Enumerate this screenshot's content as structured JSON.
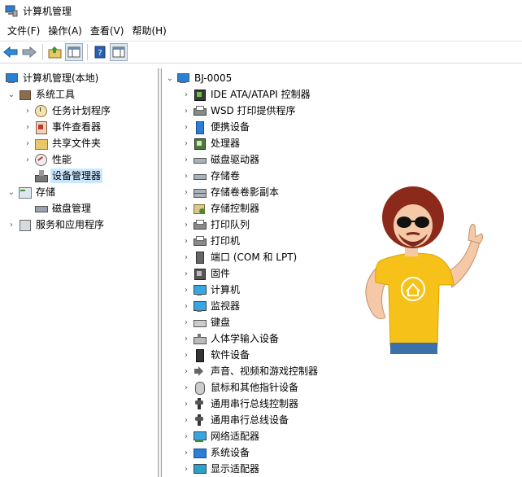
{
  "window": {
    "title": "计算机管理"
  },
  "menu": [
    "文件(F)",
    "操作(A)",
    "查看(V)",
    "帮助(H)"
  ],
  "toolbar": [
    "back-icon",
    "forward-icon",
    "up-folder-icon",
    "show-hide-tree-icon",
    "help-icon",
    "properties-icon"
  ],
  "left_tree": [
    {
      "label": "计算机管理(本地)",
      "icon": "computer-manage-icon",
      "level": 0,
      "arrow": ""
    },
    {
      "label": "系统工具",
      "icon": "tools-icon",
      "level": 1,
      "arrow": "expanded"
    },
    {
      "label": "任务计划程序",
      "icon": "clock-icon",
      "level": 2,
      "arrow": "collapsed"
    },
    {
      "label": "事件查看器",
      "icon": "event-viewer-icon",
      "level": 2,
      "arrow": "collapsed"
    },
    {
      "label": "共享文件夹",
      "icon": "shared-folder-icon",
      "level": 2,
      "arrow": "collapsed"
    },
    {
      "label": "性能",
      "icon": "performance-icon",
      "level": 2,
      "arrow": "collapsed"
    },
    {
      "label": "设备管理器",
      "icon": "device-manager-icon",
      "level": 2,
      "arrow": "",
      "selected": true
    },
    {
      "label": "存储",
      "icon": "storage-icon",
      "level": 1,
      "arrow": "expanded"
    },
    {
      "label": "磁盘管理",
      "icon": "disk-icon",
      "level": 2,
      "arrow": ""
    },
    {
      "label": "服务和应用程序",
      "icon": "services-icon",
      "level": 1,
      "arrow": "collapsed"
    }
  ],
  "device_tree": {
    "root": "BJ-0005",
    "items": [
      {
        "label": "IDE ATA/ATAPI 控制器",
        "icon": "ide-controller-icon"
      },
      {
        "label": "WSD 打印提供程序",
        "icon": "printer-icon"
      },
      {
        "label": "便携设备",
        "icon": "portable-device-icon"
      },
      {
        "label": "处理器",
        "icon": "processor-icon"
      },
      {
        "label": "磁盘驱动器",
        "icon": "disk-drive-icon"
      },
      {
        "label": "存储卷",
        "icon": "storage-volume-icon"
      },
      {
        "label": "存储卷卷影副本",
        "icon": "shadow-copy-icon"
      },
      {
        "label": "存储控制器",
        "icon": "storage-controller-icon"
      },
      {
        "label": "打印队列",
        "icon": "print-queue-icon"
      },
      {
        "label": "打印机",
        "icon": "printer-icon"
      },
      {
        "label": "端口 (COM 和 LPT)",
        "icon": "port-icon"
      },
      {
        "label": "固件",
        "icon": "firmware-icon"
      },
      {
        "label": "计算机",
        "icon": "computer-icon"
      },
      {
        "label": "监视器",
        "icon": "monitor-icon"
      },
      {
        "label": "键盘",
        "icon": "keyboard-icon"
      },
      {
        "label": "人体学输入设备",
        "icon": "hid-icon"
      },
      {
        "label": "软件设备",
        "icon": "software-device-icon"
      },
      {
        "label": "声音、视频和游戏控制器",
        "icon": "sound-icon"
      },
      {
        "label": "鼠标和其他指针设备",
        "icon": "mouse-icon"
      },
      {
        "label": "通用串行总线控制器",
        "icon": "usb-icon"
      },
      {
        "label": "通用串行总线设备",
        "icon": "usb-icon"
      },
      {
        "label": "网络适配器",
        "icon": "network-adapter-icon"
      },
      {
        "label": "系统设备",
        "icon": "system-device-icon"
      },
      {
        "label": "显示适配器",
        "icon": "display-adapter-icon"
      }
    ]
  },
  "colors": {
    "selection": "#cce8ff",
    "accent": "#2b7fd4",
    "shirt": "#f6c21a"
  }
}
